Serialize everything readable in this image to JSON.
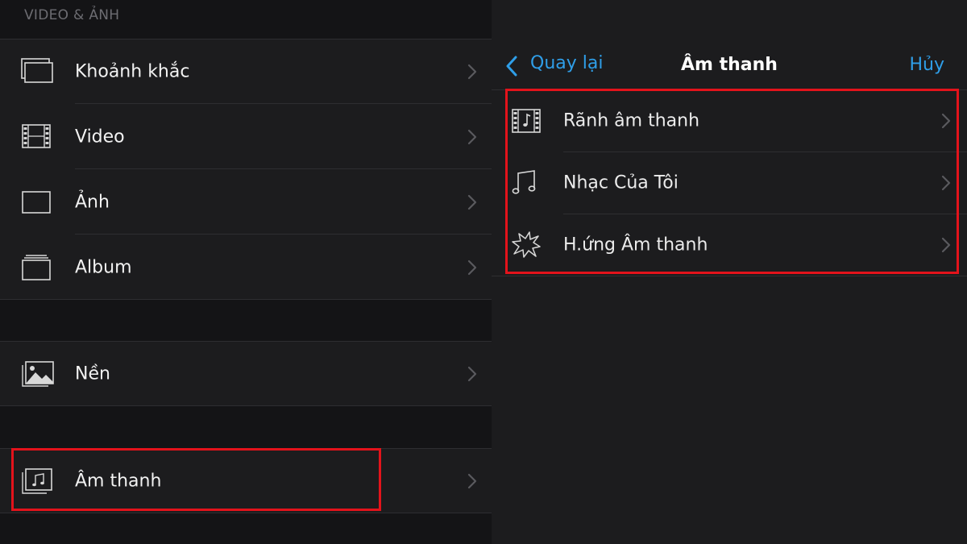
{
  "left_panel": {
    "section_header": "VIDEO & ẢNH",
    "items": [
      {
        "label": "Khoảnh khắc",
        "icon": "moments-icon"
      },
      {
        "label": "Video",
        "icon": "film-icon"
      },
      {
        "label": "Ảnh",
        "icon": "photo-frame-icon"
      },
      {
        "label": "Album",
        "icon": "album-icon"
      },
      {
        "label": "Nền",
        "icon": "background-image-icon"
      },
      {
        "label": "Âm thanh",
        "icon": "audio-icon"
      }
    ]
  },
  "right_panel": {
    "nav": {
      "back_label": "Quay lại",
      "title": "Âm thanh",
      "cancel_label": "Hủy"
    },
    "items": [
      {
        "label": "Rãnh âm thanh",
        "icon": "soundtrack-film-icon"
      },
      {
        "label": "Nhạc Của Tôi",
        "icon": "music-note-icon"
      },
      {
        "label": "H.ứng Âm thanh",
        "icon": "sound-effect-burst-icon"
      }
    ]
  },
  "colors": {
    "background": "#1c1c1e",
    "section_gap": "#141416",
    "accent_blue": "#2f9ee8",
    "highlight_red": "#e3131b"
  }
}
